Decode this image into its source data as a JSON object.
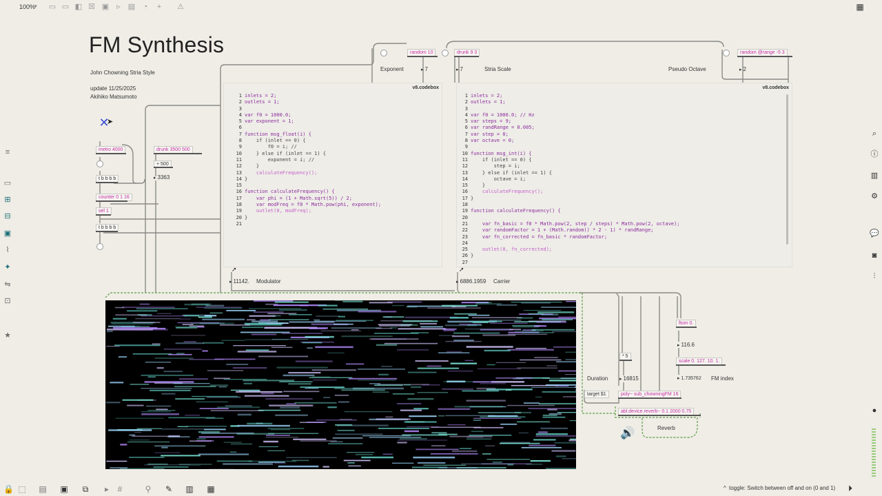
{
  "toolbar": {
    "zoom": "100%"
  },
  "patcher": {
    "title": "FM Synthesis",
    "subtitle": "John Chowning Stria Style",
    "update": "update 11/25/2025",
    "author": "Akihiko Matsumoto"
  },
  "objects": {
    "metro": "metro 4000",
    "drunk_left": "drunk 3500 500",
    "plus_500": "+ 500",
    "num_3363": "3363",
    "bbbb1": "t b b b b",
    "counter": "counter 0 1 16",
    "sel": "sel 1",
    "bbbb2": "t b b b b",
    "random10": "random 10",
    "drunk93": "drunk 9 3",
    "exponent_label": "Exponent",
    "exponent_num": "7",
    "stria_num": "7",
    "stria_label": "Stria Scale",
    "pseudo_label": "Pseudo Octave",
    "random_range": "random @range -5 3",
    "pseudo_num": "2",
    "mod_num": "11142.",
    "mod_label": "Modulator",
    "car_num": "6886.1959",
    "car_label": "Carrier",
    "ftom": "ftom 0.",
    "ftom_num": "116.6",
    "scale": "scale 0. 127. 10. 1.",
    "fm_index_num": "1.735762",
    "fm_index_label": "FM index",
    "times5": "* 5",
    "duration_label": "Duration",
    "duration_num": "16815",
    "target": "target $1",
    "poly": "poly~ sub_chowningFM 16",
    "reverb_obj": "abl.device.reverb~ 0.1 2000 0.75",
    "reverb_label": "Reverb"
  },
  "codebox_left": {
    "header": "v8.codebox",
    "lines": [
      "inlets = 2;",
      "outlets = 1;",
      "",
      "var f0 = 1000.0;",
      "var exponent = 1;",
      "",
      "function msg_float(i) {",
      "    if (inlet == 0) {",
      "        f0 = i; //",
      "    } else if (inlet == 1) {",
      "        exponent = i; //",
      "    }",
      "    calculateFrequency();",
      "}",
      "",
      "function calculateFrequency() {",
      "    var phi = (1 + Math.sqrt(5)) / 2;",
      "    var modFreq = f0 * Math.pow(phi, exponent);",
      "    outlet(0, modFreq);",
      "}",
      ""
    ]
  },
  "codebox_right": {
    "header": "v8.codebox",
    "lines": [
      "inlets = 2;",
      "outlets = 1;",
      "",
      "var f0 = 1000.0; // Hz",
      "var steps = 9;",
      "var randRange = 0.005;",
      "var step = 0;",
      "var octave = 0;",
      "",
      "function msg_int(i) {",
      "    if (inlet == 0) {",
      "        step = i;",
      "    } else if (inlet == 1) {",
      "        octave = i;",
      "    }",
      "    calculateFrequency();",
      "}",
      "",
      "function calculateFrequency() {",
      "",
      "    var fn_basic = f0 * Math.pow(2, step / steps) * Math.pow(2, octave);",
      "    var randomFactor = 1 + (Math.random() * 2 - 1) * randRange;",
      "    var fn_corrected = fn_basic * randomFactor;",
      "",
      "    outlet(0, fn_corrected);",
      "}",
      ""
    ]
  },
  "status": {
    "hint": "toggle: Switch between off and on (0 and 1)"
  },
  "colors": {
    "background": "#efede6",
    "accent": "#c42fa3",
    "keyword": "#9a2aa1",
    "speaker": "#3b4fd6"
  },
  "icons": {
    "left": [
      "list-icon",
      "rect-icon",
      "blocks-icon",
      "timeline-icon",
      "image-icon",
      "clip-icon",
      "puzzle-icon",
      "link-icon",
      "frame-icon",
      "star-icon"
    ],
    "right": [
      "search-icon",
      "info-icon",
      "grid-icon",
      "network-icon",
      "chat-icon",
      "camera-icon",
      "sliders-icon",
      "dot-icon"
    ],
    "bottom": [
      "lock-icon",
      "select-icon",
      "presentation-icon",
      "console-icon",
      "window-icon",
      "debug-icon",
      "grid-toggle-icon",
      "wand-icon",
      "wrench-icon",
      "bars-icon",
      "dsp-icon"
    ]
  }
}
